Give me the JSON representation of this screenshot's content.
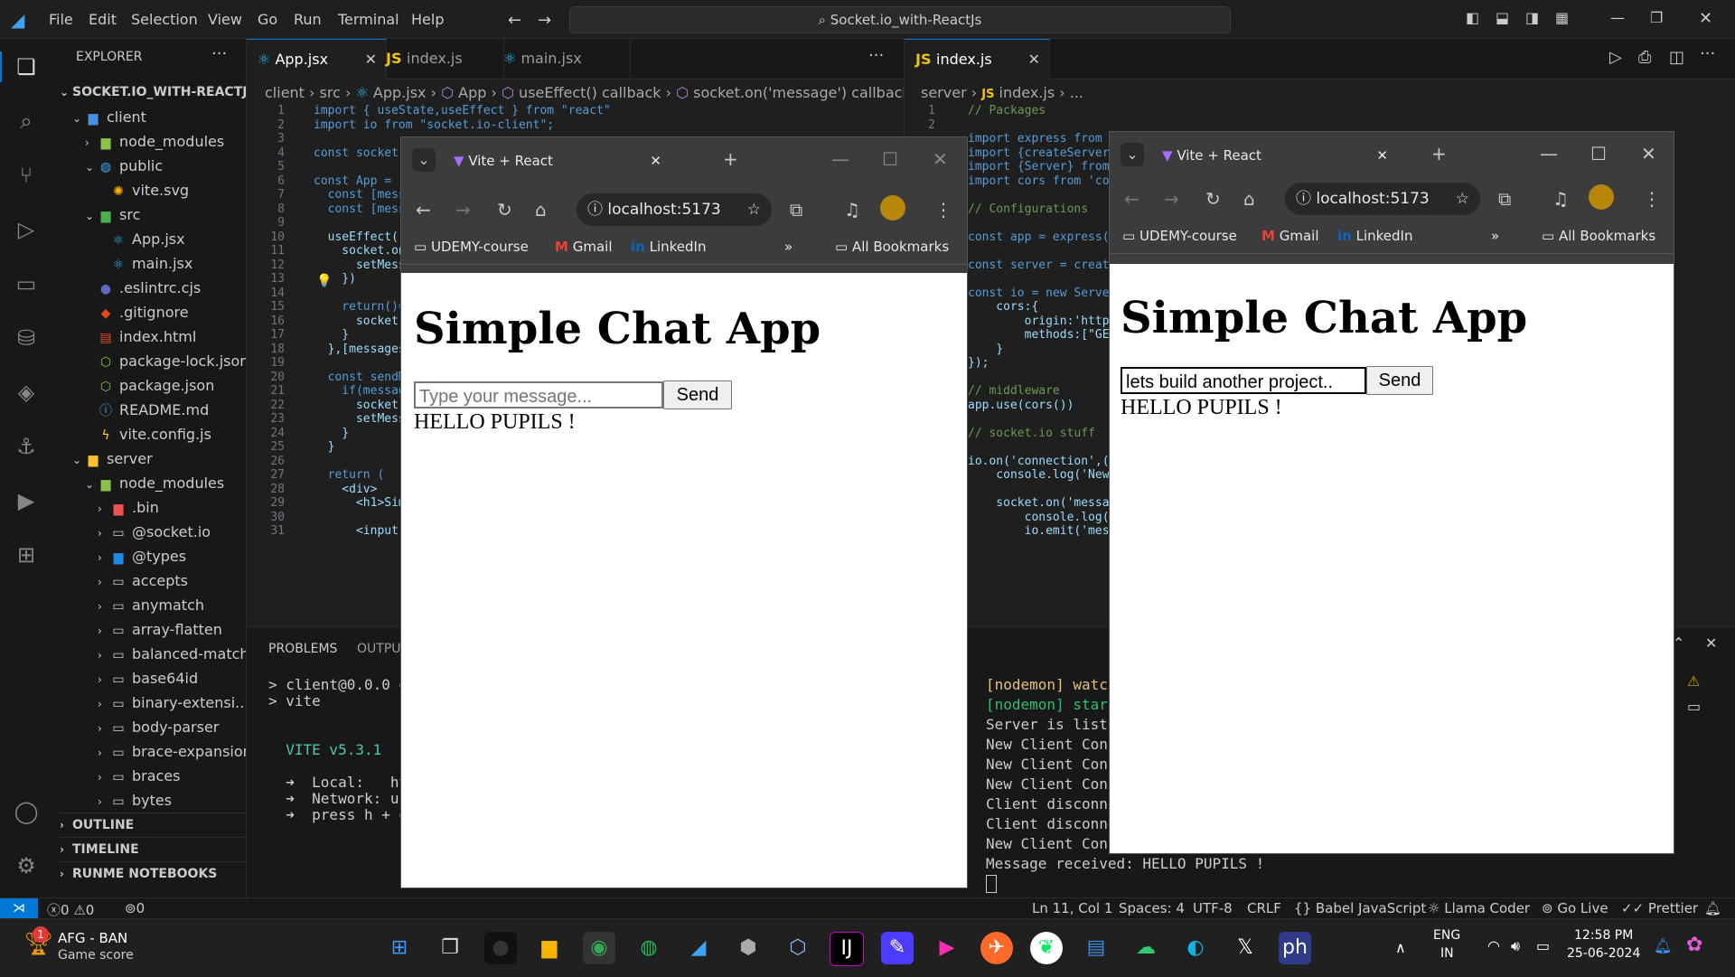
{
  "menubar": {
    "items": [
      "File",
      "Edit",
      "Selection",
      "View",
      "Go",
      "Run",
      "Terminal",
      "Help"
    ],
    "search": "Socket.io_with-ReactJs"
  },
  "explorer": {
    "title": "EXPLORER",
    "root": "SOCKET.IO_WITH-REACTJS",
    "items": [
      {
        "label": "client"
      },
      {
        "label": "node_modules"
      },
      {
        "label": "public"
      },
      {
        "label": "vite.svg"
      },
      {
        "label": "src"
      },
      {
        "label": "App.jsx"
      },
      {
        "label": "main.jsx"
      },
      {
        "label": ".eslintrc.cjs"
      },
      {
        "label": ".gitignore"
      },
      {
        "label": "index.html"
      },
      {
        "label": "package-lock.json"
      },
      {
        "label": "package.json"
      },
      {
        "label": "README.md"
      },
      {
        "label": "vite.config.js"
      },
      {
        "label": "server"
      },
      {
        "label": "node_modules"
      },
      {
        "label": ".bin"
      },
      {
        "label": "@socket.io"
      },
      {
        "label": "@types"
      },
      {
        "label": "accepts"
      },
      {
        "label": "anymatch"
      },
      {
        "label": "array-flatten"
      },
      {
        "label": "balanced-match"
      },
      {
        "label": "base64id"
      },
      {
        "label": "binary-extensi..."
      },
      {
        "label": "body-parser"
      },
      {
        "label": "brace-expansion"
      },
      {
        "label": "braces"
      },
      {
        "label": "bytes"
      }
    ],
    "sections": [
      "OUTLINE",
      "TIMELINE",
      "RUNME NOTEBOOKS"
    ]
  },
  "editor_left": {
    "tabs": [
      "App.jsx",
      "index.js",
      "main.jsx"
    ],
    "breadcrumb": [
      "client",
      "src",
      "App.jsx",
      "App",
      "useEffect() callback",
      "socket.on('message') callback"
    ],
    "line_numbers": [
      "1",
      "2",
      "3",
      "4",
      "5",
      "6",
      "7",
      "8",
      "9",
      "10",
      "11",
      "12",
      "13",
      "14",
      "15",
      "16",
      "17",
      "18",
      "19",
      "20",
      "21",
      "22",
      "23",
      "24",
      "25",
      "26",
      "27",
      "28",
      "29",
      "30",
      "31"
    ],
    "lines": [
      "import { useState,useEffect } from \"react\"",
      "import io from \"socket.io-client\";",
      "",
      "const socket",
      "",
      "const App = (",
      "  const [mess",
      "  const [mess",
      "",
      "  useEffect((",
      "    socket.on",
      "      setMess",
      "    })",
      "",
      "    return()=",
      "      socket.",
      "    }",
      "  },[messages",
      "",
      "  const sendM",
      "    if(messag",
      "      socket.",
      "      setMess",
      "    }",
      "  }",
      "",
      "  return (",
      "    <div>",
      "      <h1>Sim",
      "",
      "      <input"
    ]
  },
  "editor_right": {
    "tab": "index.js",
    "breadcrumb": [
      "server",
      "index.js",
      "..."
    ],
    "line_numbers": [
      "1",
      "2"
    ],
    "lines": [
      "// Packages",
      "",
      "import express from",
      "import {createServer",
      "import {Server} from",
      "import cors from 'co",
      "",
      "// Configurations",
      "",
      "const app = express(",
      "",
      "const server = creat",
      "",
      "const io = new Serve",
      "    cors:{",
      "        origin:'http",
      "        methods:[\"GE",
      "    }",
      "});",
      "",
      "// middleware",
      "app.use(cors())",
      "",
      "// socket.io stuff",
      "",
      "io.on('connection',(",
      "    console.log('New",
      "",
      "    socket.on('messa",
      "        console.log(",
      "        io.emit('mes"
    ]
  },
  "panel": {
    "tabs": [
      "PROBLEMS",
      "OUTPUT"
    ],
    "left_terminal": [
      "> client@0.0.0 d",
      "> vite",
      "",
      "",
      "  VITE v5.3.1  r",
      "",
      "  ➜  Local:   ht",
      "  ➜  Network: us",
      "  ➜  press h + e"
    ],
    "right_terminal": [
      "[nodemon] watch",
      "[nodemon] start",
      "Server is liste",
      "New Client Conn",
      "New Client Conn",
      "New Client Conn",
      "Client disconne",
      "Client disconne",
      "New Client Conn",
      "Message received: HELLO PUPILS !"
    ]
  },
  "browser_left": {
    "tab_title": "Vite + React",
    "url": "localhost:5173",
    "bookmarks": [
      "UDEMY-course",
      "Gmail",
      "LinkedIn"
    ],
    "all_bookmarks": "All Bookmarks",
    "heading": "Simple Chat App",
    "input_placeholder": "Type your message...",
    "input_value": "",
    "send": "Send",
    "message": "HELLO PUPILS !"
  },
  "browser_right": {
    "tab_title": "Vite + React",
    "url": "localhost:5173",
    "bookmarks": [
      "UDEMY-course",
      "Gmail",
      "LinkedIn"
    ],
    "all_bookmarks": "All Bookmarks",
    "heading": "Simple Chat App",
    "input_value": "lets build another project..",
    "send": "Send",
    "message": "HELLO PUPILS !"
  },
  "statusbar": {
    "errors": "0",
    "warnings": "0",
    "ports": "0",
    "position": "Ln 11, Col 1",
    "spaces": "Spaces: 4",
    "encoding": "UTF-8",
    "eol": "CRLF",
    "language": "Babel JavaScript",
    "llama": "Llama Coder",
    "golive": "Go Live",
    "prettier": "Prettier"
  },
  "taskbar": {
    "widget_title": "AFG - BAN",
    "widget_sub": "Game score",
    "widget_badge": "1",
    "lang": "ENG",
    "region": "IN",
    "time": "12:58 PM",
    "date": "25-06-2024"
  }
}
